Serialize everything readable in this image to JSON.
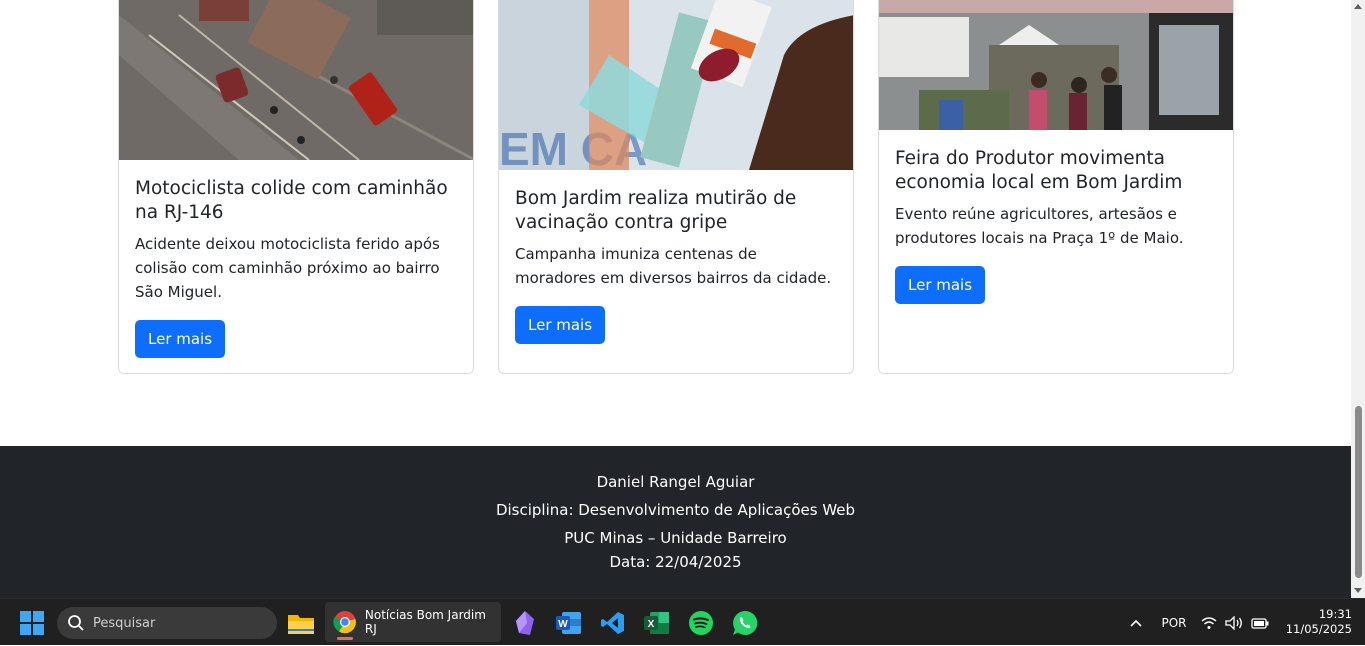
{
  "cards": [
    {
      "title": "Motociclista colide com caminhão na RJ-146",
      "text": "Acidente deixou motociclista ferido após colisão com caminhão próximo ao bairro São Miguel.",
      "button": "Ler mais",
      "image_alt": "aerial accident photo"
    },
    {
      "title": "Bom Jardim realiza mutirão de vacinação contra gripe",
      "text": "Campanha imuniza centenas de moradores em diversos bairros da cidade.",
      "button": "Ler mais",
      "image_alt": "vaccine syringe photo"
    },
    {
      "title": "Feira do Produtor movimenta economia local em Bom Jardim",
      "text": "Evento reúne agricultores, artesãos e produtores locais na Praça 1º de Maio.",
      "button": "Ler mais",
      "image_alt": "market fair photo"
    }
  ],
  "footer": {
    "author": "Daniel Rangel Aguiar",
    "discipline": "Disciplina: Desenvolvimento de Aplicações Web",
    "institution": "PUC Minas – Unidade Barreiro",
    "date": "Data: 22/04/2025"
  },
  "taskbar": {
    "search_placeholder": "Pesquisar",
    "active_window": "Notícias Bom Jardim RJ",
    "language": "POR",
    "time": "19:31",
    "date": "11/05/2025",
    "apps": [
      "start-icon",
      "file-explorer-icon",
      "chrome-icon",
      "obsidian-icon",
      "word-icon",
      "vscode-icon",
      "excel-icon",
      "spotify-icon",
      "whatsapp-icon"
    ]
  },
  "colors": {
    "button": "#0d6efd",
    "footer_bg": "#212529",
    "taskbar_bg": "#202020"
  }
}
